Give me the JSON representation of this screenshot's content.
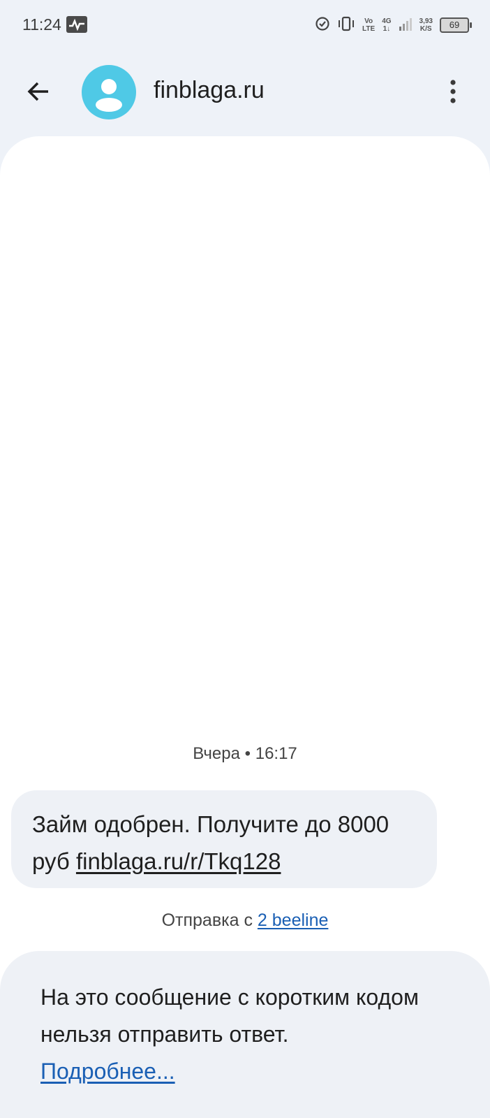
{
  "status_bar": {
    "time": "11:24",
    "volte_top": "Vo",
    "volte_bottom": "LTE",
    "network_top": "4G",
    "network_bottom": "1↓",
    "speed_top": "3,93",
    "speed_bottom": "K/S",
    "battery": "69"
  },
  "app_bar": {
    "contact_name": "finblaga.ru",
    "icons": [
      "back-arrow-icon",
      "contact-avatar-icon",
      "more-vert-icon"
    ],
    "avatar_color": "#4fc9e6"
  },
  "conversation": {
    "timestamp": "Вчера • 16:17",
    "message": {
      "text": "Займ одобрен. Получите до 8000 руб",
      "link": "finblaga.ru/r/Tkq128"
    },
    "sent_via_prefix": "Отправка с",
    "sent_via_link": "2 beeline"
  },
  "notice": {
    "text": "На это сообщение с коротким кодом нельзя отправить ответ.",
    "link": "Подробнее..."
  },
  "colors": {
    "background": "#eef2f8",
    "link": "#1a5fb4"
  }
}
